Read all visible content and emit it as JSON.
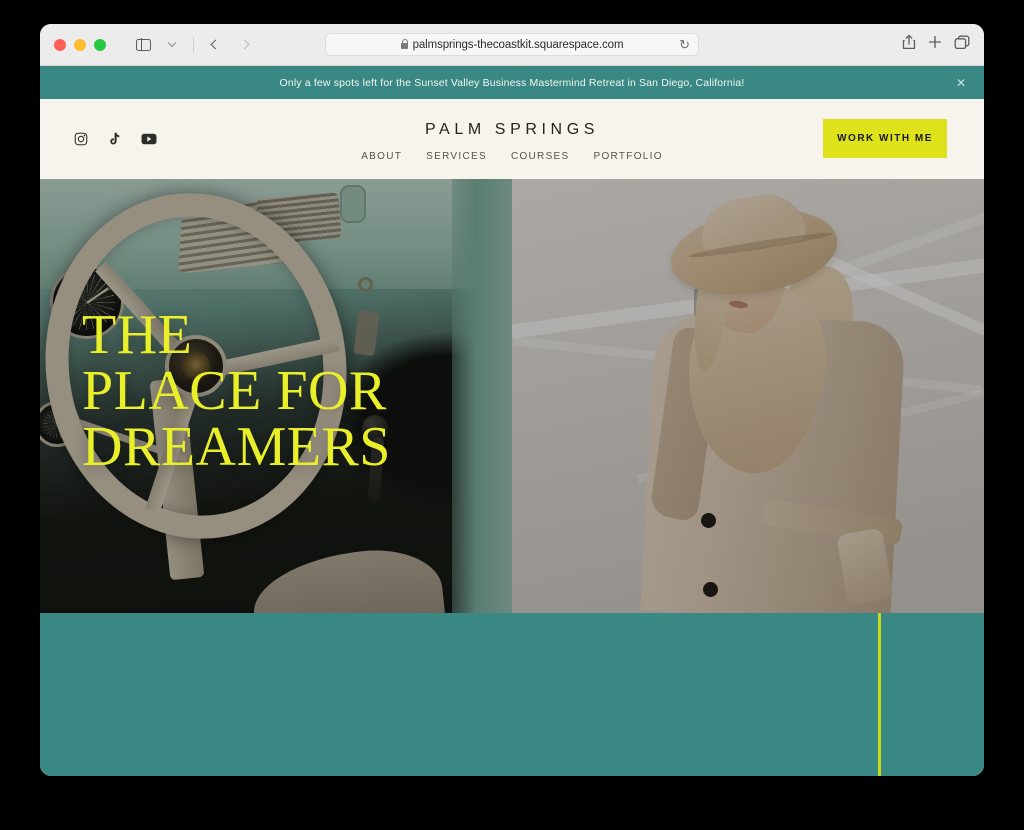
{
  "browser": {
    "traffic_lights": [
      "close",
      "minimize",
      "zoom"
    ],
    "sidebar_icon": "sidebar-icon",
    "tab_overview_chevron": "chevron-down-icon",
    "back_label": "back-arrow-icon",
    "forward_label": "forward-arrow-icon",
    "url": "palmsprings-thecoastkit.squarespace.com",
    "lock_icon": "lock-icon",
    "reload_icon": "↻",
    "share_icon": "share-icon",
    "new_tab_icon": "+",
    "tabs_icon": "tabs-icon"
  },
  "announcement": {
    "text": "Only a few spots left for the Sunset Valley Business Mastermind Retreat in San Diego, California!",
    "close_label": "✕",
    "background": "#3a8883",
    "text_color": "#f2f6f5"
  },
  "site_header": {
    "brand": "PALM SPRINGS",
    "background": "#f7f4ee",
    "socials": [
      {
        "name": "instagram-icon",
        "label": "Instagram"
      },
      {
        "name": "tiktok-icon",
        "label": "TikTok"
      },
      {
        "name": "youtube-icon",
        "label": "YouTube"
      }
    ],
    "nav": [
      {
        "label": "ABOUT"
      },
      {
        "label": "SERVICES"
      },
      {
        "label": "COURSES"
      },
      {
        "label": "PORTFOLIO"
      }
    ],
    "cta": {
      "label": "WORK WITH ME",
      "background": "#dde21a",
      "text_color": "#1b1a16"
    }
  },
  "hero": {
    "headline": "THE\nPLACE FOR\nDREAMERS",
    "headline_color": "#e9f02a",
    "left_image_alt": "Vintage car interior with mint green dashboard and cream steering wheel",
    "right_image_alt": "Woman in beige trench coat and wide-brim hat"
  },
  "footer_band": {
    "background": "#3a8883",
    "accent_line_color": "#c9da1e"
  }
}
